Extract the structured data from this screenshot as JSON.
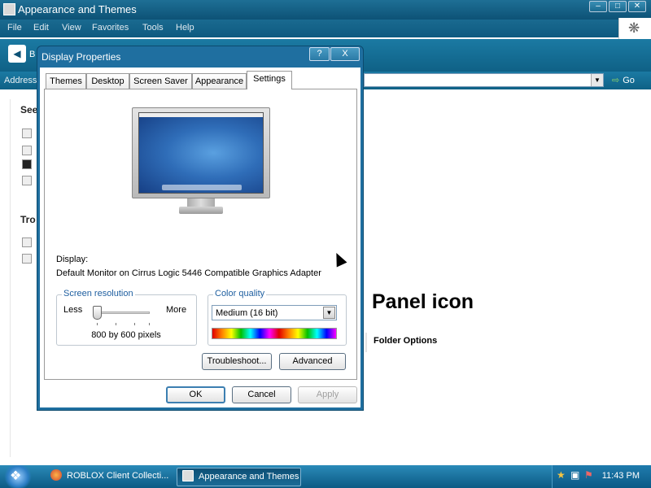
{
  "explorer": {
    "title": "Appearance and Themes",
    "menu": [
      "File",
      "Edit",
      "View",
      "Favorites",
      "Tools",
      "Help"
    ],
    "address_label": "Address",
    "go_label": "Go",
    "left_headings": [
      "See",
      "Tro"
    ],
    "main_heading_partial": "Panel icon",
    "main_link": "Folder Options"
  },
  "dialog": {
    "title": "Display Properties",
    "help_glyph": "?",
    "close_glyph": "X",
    "tabs": [
      "Themes",
      "Desktop",
      "Screen Saver",
      "Appearance",
      "Settings"
    ],
    "active_tab": "Settings",
    "display_label": "Display:",
    "display_value": "Default Monitor on Cirrus Logic 5446 Compatible Graphics Adapter",
    "screen_resolution": {
      "label": "Screen resolution",
      "less": "Less",
      "more": "More",
      "value_text": "800 by 600 pixels",
      "slider_level": 0
    },
    "color_quality": {
      "label": "Color quality",
      "selected": "Medium (16 bit)"
    },
    "buttons": {
      "troubleshoot": "Troubleshoot...",
      "advanced": "Advanced",
      "ok": "OK",
      "cancel": "Cancel",
      "apply": "Apply"
    }
  },
  "taskbar": {
    "tasks": [
      {
        "label": "ROBLOX Client Collecti...",
        "icon": "firefox-icon",
        "active": false
      },
      {
        "label": "Appearance and Themes",
        "icon": "control-panel-icon",
        "active": true
      }
    ],
    "clock": "11:43 PM"
  },
  "colors": {
    "title_bar": "#0d5276",
    "dialog_frame": "#1f6fa0",
    "group_label": "#1f5fa0"
  }
}
